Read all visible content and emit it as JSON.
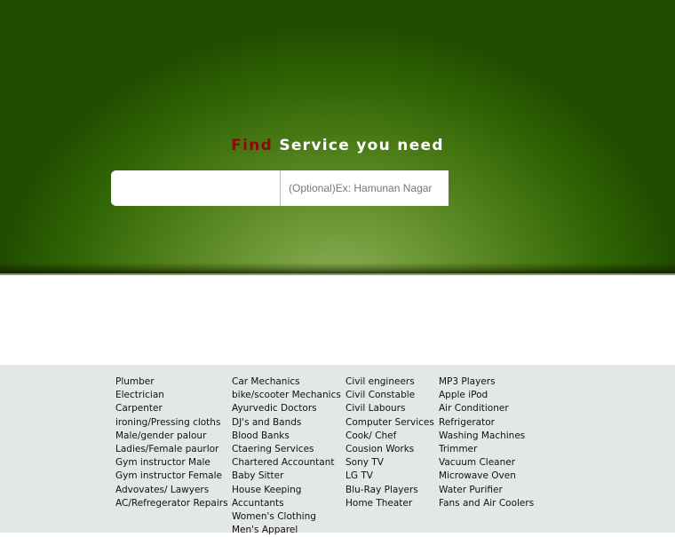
{
  "hero": {
    "title_highlight": "Find",
    "title_rest": "Service you need",
    "colors": {
      "background": "#224d00",
      "highlight": "#8b0a0a",
      "title": "#ffffff"
    }
  },
  "search": {
    "service_value": "",
    "service_placeholder": "",
    "location_value": "",
    "location_placeholder": "(Optional)Ex: Hamunan Nagar"
  },
  "categories": {
    "background": "#e1e8e6",
    "columns": [
      [
        "Plumber",
        "Electrician",
        "Carpenter",
        "ironing/Pressing cloths",
        "Male/gender palour",
        "Ladies/Female paurlor",
        "Gym instructor Male",
        "Gym instructor Female",
        "Advovates/ Lawyers",
        "AC/Refregerator Repairs"
      ],
      [
        "Car Mechanics",
        "bike/scooter Mechanics",
        "Ayurvedic Doctors",
        "DJ's and Bands",
        "Blood Banks",
        "Ctaering Services",
        "Chartered Accountant",
        "Baby Sitter",
        "House Keeping",
        "Accuntants",
        "Women's Clothing",
        "Men's Apparel"
      ],
      [
        "Civil engineers",
        "Civil Constable",
        "Civil Labours",
        "Computer Services",
        "Cook/ Chef",
        "Cousion Works",
        "Sony TV",
        "LG TV",
        "Blu-Ray Players",
        "Home Theater"
      ],
      [
        "MP3 Players",
        "Apple iPod",
        "Air Conditioner",
        "Refrigerator",
        "Washing Machines",
        "Trimmer",
        "Vacuum Cleaner",
        "Microwave Oven",
        "Water Purifier",
        "Fans and Air Coolers"
      ]
    ]
  }
}
